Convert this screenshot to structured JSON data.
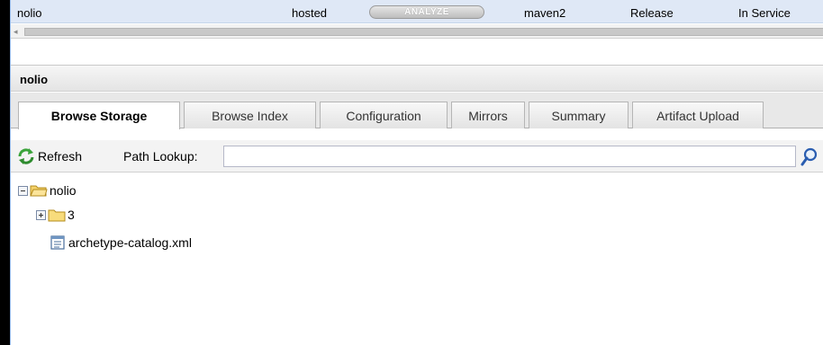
{
  "repo_row": {
    "name": "nolio",
    "type": "hosted",
    "analyze_label": "ANALYZE",
    "format": "maven2",
    "policy": "Release",
    "status": "In Service"
  },
  "panel": {
    "title": "nolio"
  },
  "tabs": [
    {
      "label": "Browse Storage",
      "active": true
    },
    {
      "label": "Browse Index",
      "active": false
    },
    {
      "label": "Configuration",
      "active": false
    },
    {
      "label": "Mirrors",
      "active": false
    },
    {
      "label": "Summary",
      "active": false
    },
    {
      "label": "Artifact Upload",
      "active": false
    }
  ],
  "toolbar": {
    "refresh_label": "Refresh",
    "path_lookup_label": "Path Lookup:",
    "path_lookup_value": "",
    "refresh_icon": "refresh-icon",
    "search_icon": "search-icon"
  },
  "tree": {
    "root": {
      "label": "nolio",
      "expanded": true,
      "icon": "folder-open-icon"
    },
    "children": [
      {
        "label": "3",
        "type": "folder",
        "expanded": false,
        "icon": "folder-icon"
      },
      {
        "label": "archetype-catalog.xml",
        "type": "file",
        "icon": "file-icon"
      }
    ]
  },
  "colors": {
    "row_highlight": "#dfe8f6",
    "accent_text": "#15428b",
    "frame_border": "#99bbe8"
  }
}
